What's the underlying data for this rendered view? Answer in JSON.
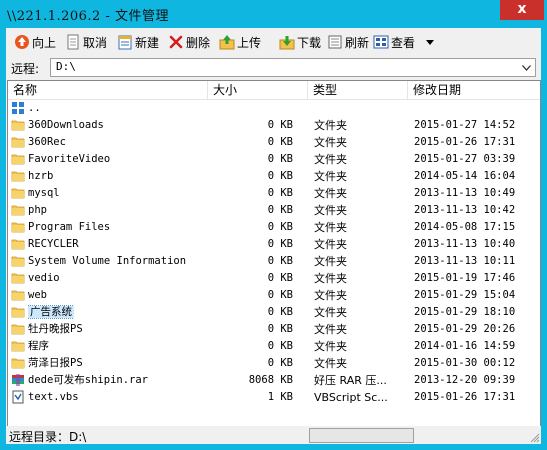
{
  "window": {
    "title": "\\\\221.1.206.2 - 文件管理",
    "close_glyph": "x"
  },
  "toolbar": {
    "up": "向上",
    "cancel": "取消",
    "new": "新建",
    "delete": "删除",
    "upload": "上传",
    "download": "下载",
    "refresh": "刷新",
    "view": "查看"
  },
  "remote": {
    "label": "远程:",
    "path": "D:\\"
  },
  "columns": {
    "name": "名称",
    "size": "大小",
    "type": "类型",
    "modified": "修改日期"
  },
  "parent_entry": "..",
  "files": [
    {
      "name": "360Downloads",
      "size": "0 KB",
      "type": "文件夹",
      "date": "2015-01-27 14:52",
      "icon": "folder-icon"
    },
    {
      "name": "360Rec",
      "size": "0 KB",
      "type": "文件夹",
      "date": "2015-01-26 17:31",
      "icon": "folder-icon"
    },
    {
      "name": "FavoriteVideo",
      "size": "0 KB",
      "type": "文件夹",
      "date": "2015-01-27 03:39",
      "icon": "folder-icon"
    },
    {
      "name": "hzrb",
      "size": "0 KB",
      "type": "文件夹",
      "date": "2014-05-14 16:04",
      "icon": "folder-icon"
    },
    {
      "name": "mysql",
      "size": "0 KB",
      "type": "文件夹",
      "date": "2013-11-13 10:49",
      "icon": "folder-icon"
    },
    {
      "name": "php",
      "size": "0 KB",
      "type": "文件夹",
      "date": "2013-11-13 10:42",
      "icon": "folder-icon"
    },
    {
      "name": "Program Files",
      "size": "0 KB",
      "type": "文件夹",
      "date": "2014-05-08 17:15",
      "icon": "folder-icon"
    },
    {
      "name": "RECYCLER",
      "size": "0 KB",
      "type": "文件夹",
      "date": "2013-11-13 10:40",
      "icon": "folder-icon"
    },
    {
      "name": "System Volume Information",
      "size": "0 KB",
      "type": "文件夹",
      "date": "2013-11-13 10:11",
      "icon": "folder-icon"
    },
    {
      "name": "vedio",
      "size": "0 KB",
      "type": "文件夹",
      "date": "2015-01-19 17:46",
      "icon": "folder-icon"
    },
    {
      "name": "web",
      "size": "0 KB",
      "type": "文件夹",
      "date": "2015-01-29 15:04",
      "icon": "folder-icon"
    },
    {
      "name": "广告系统",
      "size": "0 KB",
      "type": "文件夹",
      "date": "2015-01-29 18:10",
      "icon": "folder-icon",
      "selected": true
    },
    {
      "name": "牡丹晚报PS",
      "size": "0 KB",
      "type": "文件夹",
      "date": "2015-01-29 20:26",
      "icon": "folder-icon"
    },
    {
      "name": "程序",
      "size": "0 KB",
      "type": "文件夹",
      "date": "2014-01-16 14:59",
      "icon": "folder-icon"
    },
    {
      "name": "菏泽日报PS",
      "size": "0 KB",
      "type": "文件夹",
      "date": "2015-01-30 00:12",
      "icon": "folder-icon"
    },
    {
      "name": "dede可发布shipin.rar",
      "size": "8068 KB",
      "type": "好压 RAR 压...",
      "date": "2013-12-20 09:39",
      "icon": "rar-archive-icon"
    },
    {
      "name": "text.vbs",
      "size": "1 KB",
      "type": "VBScript Sc...",
      "date": "2015-01-26 17:31",
      "icon": "vbscript-file-icon"
    }
  ],
  "status": {
    "text": "远程目录：D:\\"
  }
}
